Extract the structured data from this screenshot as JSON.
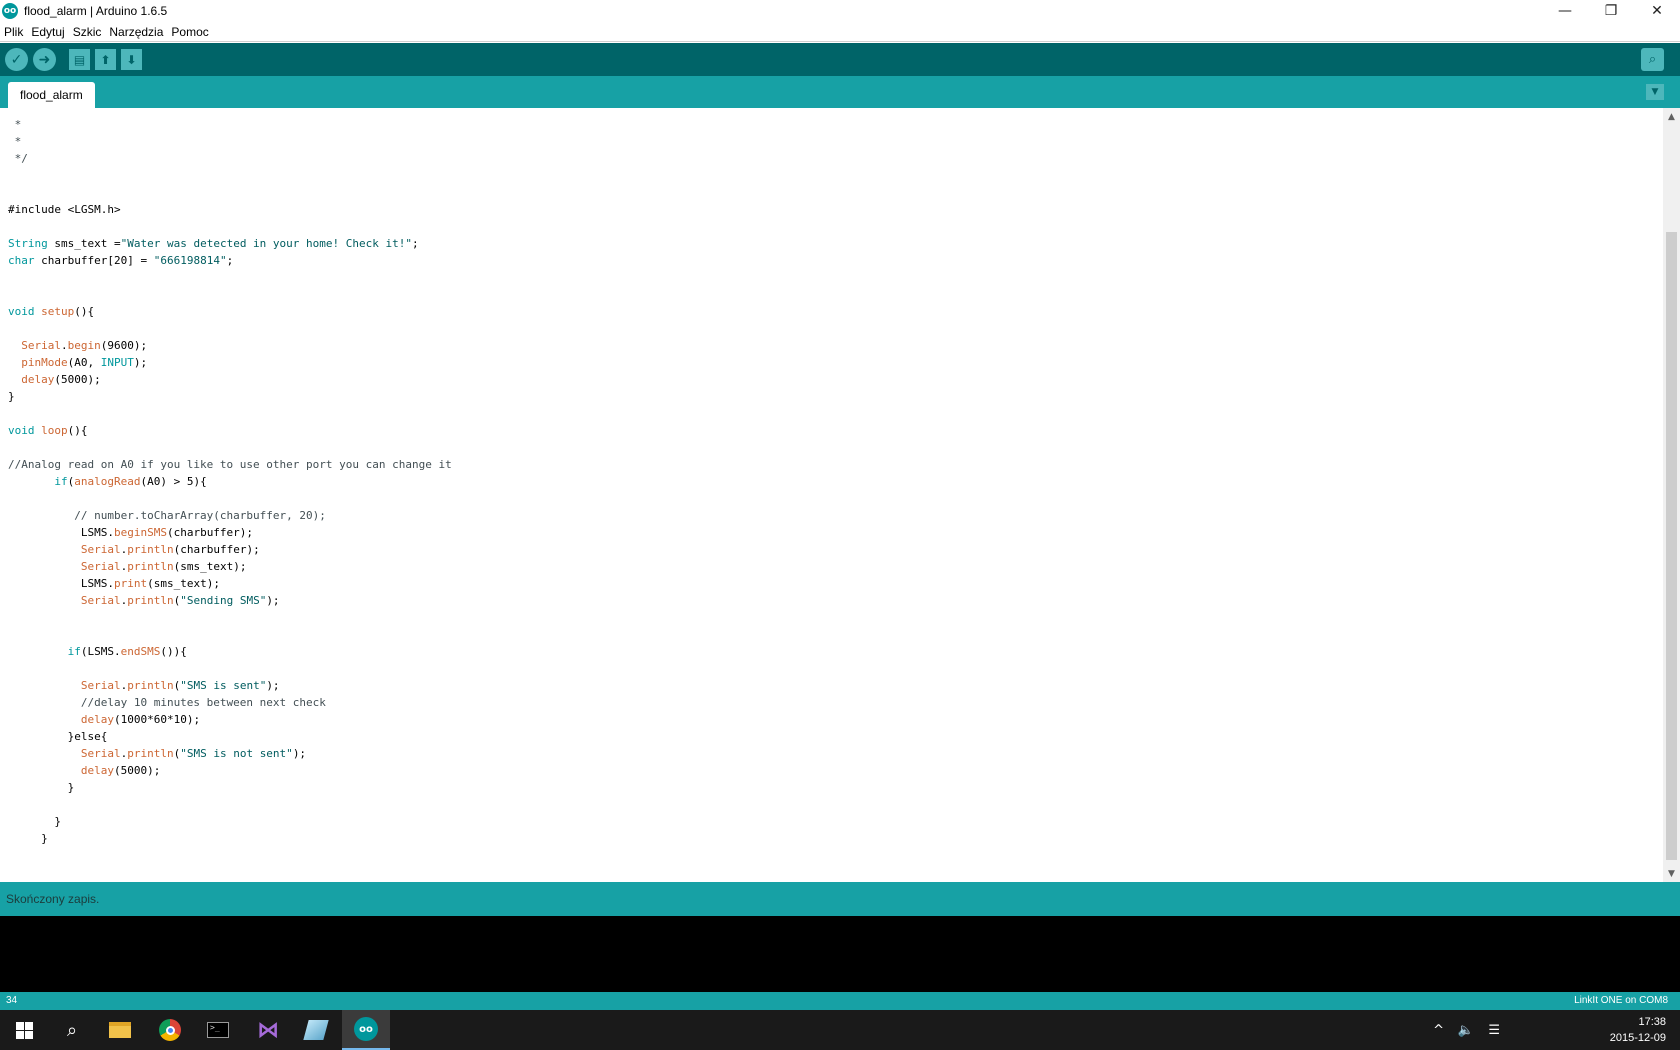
{
  "window": {
    "title": "flood_alarm | Arduino 1.6.5",
    "logo_text": "oo",
    "minimize_glyph": "—",
    "restore_glyph": "❐",
    "close_glyph": "✕"
  },
  "menu": [
    "Plik",
    "Edytuj",
    "Szkic",
    "Narzędzia",
    "Pomoc"
  ],
  "toolbar": {
    "verify_glyph": "✓",
    "upload_glyph": "➜",
    "new_glyph": "▤",
    "open_glyph": "⬆",
    "save_glyph": "⬇",
    "serial_glyph": "⌕"
  },
  "tab": {
    "label": "flood_alarm",
    "menu_glyph": "▼"
  },
  "scrollbar": {
    "up_glyph": "▲",
    "down_glyph": "▼"
  },
  "code_lines": [
    [
      {
        "t": " *",
        "c": "cm"
      }
    ],
    [
      {
        "t": " *",
        "c": "cm"
      }
    ],
    [
      {
        "t": " */",
        "c": "cm"
      }
    ],
    [],
    [],
    [
      {
        "t": "#include <LGSM.h>",
        "c": "n"
      }
    ],
    [],
    [
      {
        "t": "String",
        "c": "kw"
      },
      {
        "t": " sms_text =",
        "c": "n"
      },
      {
        "t": "\"Water was detected in your home! Check it!\"",
        "c": "str"
      },
      {
        "t": ";",
        "c": "n"
      }
    ],
    [
      {
        "t": "char",
        "c": "kw"
      },
      {
        "t": " charbuffer[20] = ",
        "c": "n"
      },
      {
        "t": "\"666198814\"",
        "c": "str"
      },
      {
        "t": ";",
        "c": "n"
      }
    ],
    [],
    [],
    [
      {
        "t": "void",
        "c": "kw"
      },
      {
        "t": " ",
        "c": "n"
      },
      {
        "t": "setup",
        "c": "fn"
      },
      {
        "t": "(){",
        "c": "n"
      }
    ],
    [],
    [
      {
        "t": "  ",
        "c": "n"
      },
      {
        "t": "Serial",
        "c": "fn"
      },
      {
        "t": ".",
        "c": "n"
      },
      {
        "t": "begin",
        "c": "fn"
      },
      {
        "t": "(9600);",
        "c": "n"
      }
    ],
    [
      {
        "t": "  ",
        "c": "n"
      },
      {
        "t": "pinMode",
        "c": "fn"
      },
      {
        "t": "(A0, ",
        "c": "n"
      },
      {
        "t": "INPUT",
        "c": "kw"
      },
      {
        "t": ");",
        "c": "n"
      }
    ],
    [
      {
        "t": "  ",
        "c": "n"
      },
      {
        "t": "delay",
        "c": "fn"
      },
      {
        "t": "(5000);",
        "c": "n"
      }
    ],
    [
      {
        "t": "}",
        "c": "n"
      }
    ],
    [],
    [
      {
        "t": "void",
        "c": "kw"
      },
      {
        "t": " ",
        "c": "n"
      },
      {
        "t": "loop",
        "c": "fn"
      },
      {
        "t": "(){",
        "c": "n"
      }
    ],
    [],
    [
      {
        "t": "//Analog read on A0 if you like to use other port you can change it",
        "c": "cm"
      }
    ],
    [
      {
        "t": "       ",
        "c": "n"
      },
      {
        "t": "if",
        "c": "kw"
      },
      {
        "t": "(",
        "c": "n"
      },
      {
        "t": "analogRead",
        "c": "fn"
      },
      {
        "t": "(A0) > 5){",
        "c": "n"
      }
    ],
    [],
    [
      {
        "t": "          // number.toCharArray(charbuffer, 20);",
        "c": "cm"
      }
    ],
    [
      {
        "t": "           LSMS.",
        "c": "n"
      },
      {
        "t": "beginSMS",
        "c": "fn"
      },
      {
        "t": "(charbuffer);",
        "c": "n"
      }
    ],
    [
      {
        "t": "           ",
        "c": "n"
      },
      {
        "t": "Serial",
        "c": "fn"
      },
      {
        "t": ".",
        "c": "n"
      },
      {
        "t": "println",
        "c": "fn"
      },
      {
        "t": "(charbuffer);",
        "c": "n"
      }
    ],
    [
      {
        "t": "           ",
        "c": "n"
      },
      {
        "t": "Serial",
        "c": "fn"
      },
      {
        "t": ".",
        "c": "n"
      },
      {
        "t": "println",
        "c": "fn"
      },
      {
        "t": "(sms_text);",
        "c": "n"
      }
    ],
    [
      {
        "t": "           LSMS.",
        "c": "n"
      },
      {
        "t": "print",
        "c": "fn"
      },
      {
        "t": "(sms_text);",
        "c": "n"
      }
    ],
    [
      {
        "t": "           ",
        "c": "n"
      },
      {
        "t": "Serial",
        "c": "fn"
      },
      {
        "t": ".",
        "c": "n"
      },
      {
        "t": "println",
        "c": "fn"
      },
      {
        "t": "(",
        "c": "n"
      },
      {
        "t": "\"Sending SMS\"",
        "c": "str"
      },
      {
        "t": ");",
        "c": "n"
      }
    ],
    [],
    [],
    [
      {
        "t": "         ",
        "c": "n"
      },
      {
        "t": "if",
        "c": "kw"
      },
      {
        "t": "(LSMS.",
        "c": "n"
      },
      {
        "t": "endSMS",
        "c": "fn"
      },
      {
        "t": "()){",
        "c": "n"
      }
    ],
    [],
    [
      {
        "t": "           ",
        "c": "n"
      },
      {
        "t": "Serial",
        "c": "fn"
      },
      {
        "t": ".",
        "c": "n"
      },
      {
        "t": "println",
        "c": "fn"
      },
      {
        "t": "(",
        "c": "n"
      },
      {
        "t": "\"SMS is sent\"",
        "c": "str"
      },
      {
        "t": ");",
        "c": "n"
      }
    ],
    [
      {
        "t": "           //delay 10 minutes between next check",
        "c": "cm"
      }
    ],
    [
      {
        "t": "           ",
        "c": "n"
      },
      {
        "t": "delay",
        "c": "fn"
      },
      {
        "t": "(1000*60*10);",
        "c": "n"
      }
    ],
    [
      {
        "t": "         }else{",
        "c": "n"
      }
    ],
    [
      {
        "t": "           ",
        "c": "n"
      },
      {
        "t": "Serial",
        "c": "fn"
      },
      {
        "t": ".",
        "c": "n"
      },
      {
        "t": "println",
        "c": "fn"
      },
      {
        "t": "(",
        "c": "n"
      },
      {
        "t": "\"SMS is not sent\"",
        "c": "str"
      },
      {
        "t": ");",
        "c": "n"
      }
    ],
    [
      {
        "t": "           ",
        "c": "n"
      },
      {
        "t": "delay",
        "c": "fn"
      },
      {
        "t": "(5000);",
        "c": "n"
      }
    ],
    [
      {
        "t": "         }",
        "c": "n"
      }
    ],
    [],
    [
      {
        "t": "       }",
        "c": "n"
      }
    ],
    [
      {
        "t": "     }",
        "c": "n"
      }
    ]
  ],
  "syntax_colors": {
    "kw": "#00979c",
    "fn": "#cc6633",
    "str": "#005c5f",
    "cm": "#434f54",
    "n": "#000000"
  },
  "status": {
    "message": "Skończony zapis."
  },
  "footer": {
    "line": "34",
    "board": "LinkIt ONE on COM8"
  },
  "taskbar": {
    "search_glyph": "⌕",
    "cmd_glyph": ">_",
    "vs_glyph": "⋈",
    "arduino_glyph": "oo",
    "tray_chevron": "^",
    "tray_volume": "🔈",
    "tray_notify": "☰",
    "time": "17:38",
    "date": "2015-12-09"
  },
  "colors": {
    "toolbar_bg": "#006468",
    "tabbar_bg": "#17a1a5",
    "console_bg": "#000000"
  }
}
